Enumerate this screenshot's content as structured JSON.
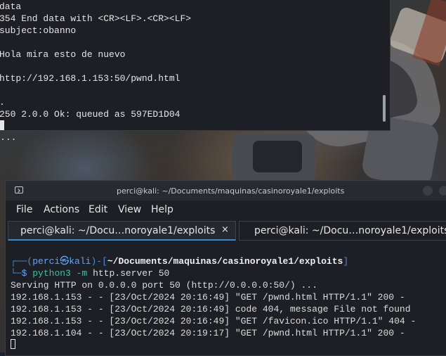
{
  "top_terminal": {
    "lines": [
      "data",
      "354 End data with <CR><LF>.<CR><LF>",
      "subject:obanno",
      "",
      "Hola mira esto de nuevo",
      "",
      "http://192.168.1.153:50/pwnd.html",
      "",
      ".",
      "250 2.0.0 Ok: queued as 597ED1D04"
    ]
  },
  "desktop": {
    "ellipsis": "..."
  },
  "bottom_terminal": {
    "title": "perci@kali: ~/Documents/maquinas/casinoroyale1/exploits",
    "menu": [
      "File",
      "Actions",
      "Edit",
      "View",
      "Help"
    ],
    "tabs": [
      {
        "label": "perci@kali: ~/Docu…noroyale1/exploits",
        "close": "×"
      },
      {
        "label": "perci@kali: ~/Docu…noroyale1/exploits"
      }
    ],
    "prompt": {
      "open": "┌──(",
      "user": "perci",
      "at": "㉿",
      "host": "kali",
      "mid": ")-[",
      "path": "~/Documents/maquinas/casinoroyale1/exploits",
      "close": "]",
      "line2": "└─",
      "dollar": "$",
      "cmd": "python3",
      "flag": "-m",
      "args": "http.server 50"
    },
    "output": [
      "Serving HTTP on 0.0.0.0 port 50 (http://0.0.0.0:50/) ...",
      "192.168.1.153 - - [23/Oct/2024 20:16:49] \"GET /pwnd.html HTTP/1.1\" 200 -",
      "192.168.1.153 - - [23/Oct/2024 20:16:49] code 404, message File not found",
      "192.168.1.153 - - [23/Oct/2024 20:16:49] \"GET /favicon.ico HTTP/1.1\" 404 -",
      "192.168.1.104 - - [23/Oct/2024 20:19:17] \"GET /pwnd.html HTTP/1.1\" 200 -"
    ]
  }
}
